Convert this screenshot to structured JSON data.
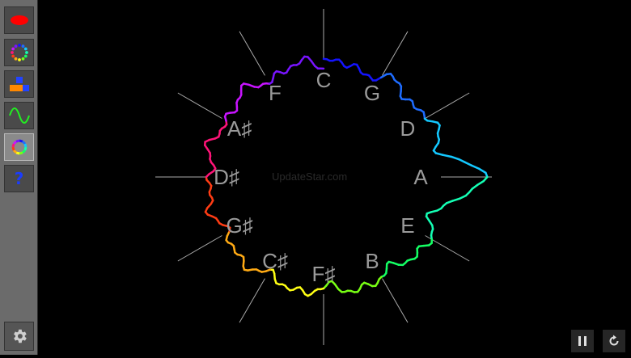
{
  "toolbar": {
    "tools": [
      {
        "icon": "red-ellipse-icon"
      },
      {
        "icon": "color-dots-circle-icon"
      },
      {
        "icon": "blocks-icon"
      },
      {
        "icon": "sine-wave-icon"
      },
      {
        "icon": "color-wheel-icon"
      },
      {
        "icon": "help-question-icon"
      }
    ],
    "help_glyph": "?"
  },
  "watermark": "UpdateStar.com",
  "circle_of_fifths": {
    "notes": [
      "C",
      "G",
      "D",
      "A",
      "E",
      "B",
      "F♯",
      "C♯",
      "G♯",
      "D♯",
      "A♯",
      "F"
    ],
    "colors": [
      "#1414ff",
      "#1e6cff",
      "#14c8ff",
      "#14ffb4",
      "#14ff64",
      "#78ff14",
      "#ffff14",
      "#ffaa14",
      "#ff3c14",
      "#ff1478",
      "#c814ff",
      "#7814ff"
    ],
    "note_color": "#9a9a9a",
    "line_color": "#aaaaaa"
  },
  "controls": {
    "pause_icon": "pause-icon",
    "restart_icon": "restart-icon"
  }
}
